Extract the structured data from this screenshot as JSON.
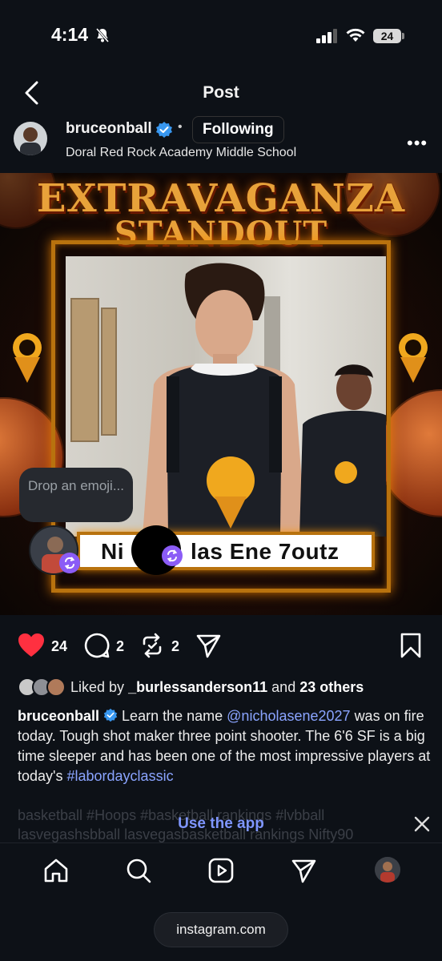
{
  "status_bar": {
    "time": "4:14",
    "battery": "24"
  },
  "nav": {
    "title": "Post"
  },
  "post": {
    "username": "bruceonball",
    "separator": "•",
    "follow_label": "Following",
    "location": "Doral Red Rock Academy Middle School",
    "image": {
      "headline_1": "EXTRAVAGANZA",
      "headline_2": "STANDOUT",
      "player_name_left": "Ni",
      "player_name_right": "las Ene 7outz"
    },
    "emoji_prompt": "Drop an emoji...",
    "likes_count": "24",
    "comments_count": "2",
    "reposts_count": "2",
    "liked_by_prefix": "Liked by",
    "liked_by_user": "_burlessanderson11",
    "liked_by_and": "and",
    "liked_by_others": "23 others",
    "caption": {
      "username": "bruceonball",
      "text_1": "Learn the name",
      "mention": "@nicholasene2027",
      "text_2": "was on fire today. Tough shot maker three point shooter. The 6'6 SF is a big time sleeper and has been one of the most impressive players at today's",
      "hashtag": "#labordayclassic",
      "faded_line_1": "basketball #Hoops #basketball rankings #lvbball",
      "faded_line_2": "lasvegashsbball lasvegasbasketball rankings Nifty90"
    }
  },
  "use_app_label": "Use the app",
  "browser": {
    "url": "instagram.com"
  },
  "colors": {
    "background": "#0d1117",
    "like_red": "#ff3040",
    "link_blue": "#8aa4ff",
    "accent_purple": "#8b5cf6",
    "frame_gold": "#b8720e"
  }
}
